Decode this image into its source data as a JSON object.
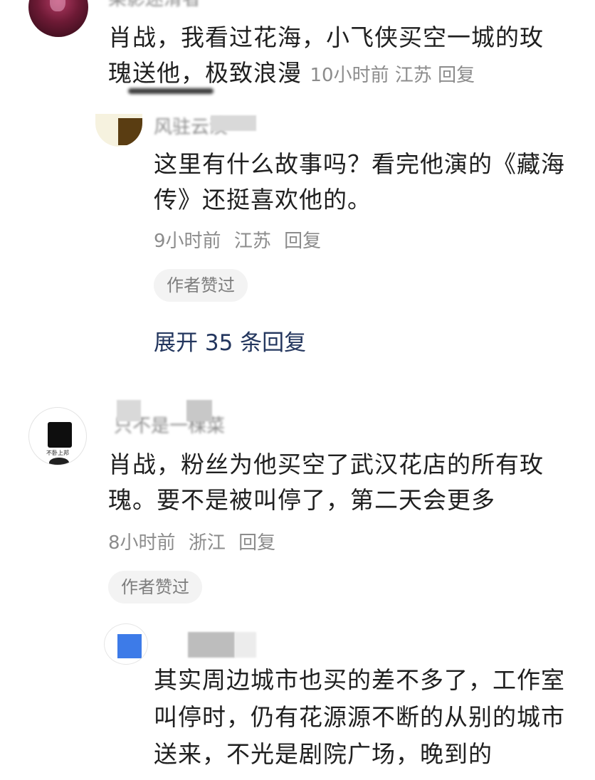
{
  "comments": [
    {
      "username": "某影迷滑者",
      "text": "肖战，我看过花海，小飞侠买空一城的玫瑰送他，极致浪漫",
      "time": "10小时前",
      "location": "江苏",
      "reply_label": "回复",
      "replies": [
        {
          "username": "风驻云淡",
          "text": "这里有什么故事吗？看完他演的《藏海传》还挺喜欢他的。",
          "time": "9小时前",
          "location": "江苏",
          "reply_label": "回复",
          "badge": "作者赞过"
        }
      ],
      "expand_label": "展开 35 条回复"
    },
    {
      "username": "只不是一棵菜",
      "avatar_text": "不卧上邦",
      "text": "肖战，粉丝为他买空了武汉花店的所有玫瑰。要不是被叫停了，第二天会更多",
      "time": "8小时前",
      "location": "浙江",
      "reply_label": "回复",
      "badge": "作者赞过",
      "replies": [
        {
          "username": "",
          "text": "其实周边城市也买的差不多了，工作室叫停时，仍有花源源不断的从别的城市送来，不光是剧院广场，晚到的"
        }
      ]
    }
  ],
  "colors": {
    "text": "#1f1f1f",
    "meta": "#8c8c8c",
    "link": "#23365e",
    "badge_bg": "#f3f3f3"
  }
}
